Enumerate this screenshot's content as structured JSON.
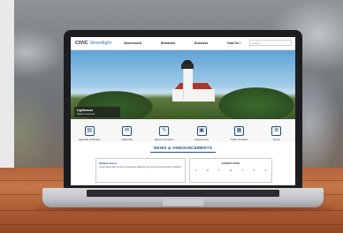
{
  "site": {
    "logo_main": "CIVIC",
    "logo_sub": "Streetlight",
    "nav": [
      "Government",
      "Residents",
      "Business",
      "How Do I"
    ],
    "search_placeholder": "Search",
    "topbar_button": "Sign In"
  },
  "hero": {
    "caption_title": "Lighthouse",
    "caption_sub": "Historic landmark"
  },
  "quick_links": [
    {
      "label": "Agendas & Minutes",
      "icon": "agenda-icon",
      "glyph": "▤"
    },
    {
      "label": "Notify Me",
      "icon": "mail-icon",
      "glyph": "✉"
    },
    {
      "label": "Report a Concern",
      "icon": "concern-icon",
      "glyph": "✎"
    },
    {
      "label": "Employment",
      "icon": "briefcase-icon",
      "glyph": "▣"
    },
    {
      "label": "Online Services",
      "icon": "services-icon",
      "glyph": "▦"
    },
    {
      "label": "Forms",
      "icon": "forms-icon",
      "glyph": "⚙"
    }
  ],
  "news": {
    "title": "NEWS & ANNOUNCEMENTS",
    "card_headline": "Sample Event",
    "card_text": "Lorem ipsum dolor sit amet consectetur adipiscing elit sed do eiusmod tempor incididunt"
  },
  "calendar": {
    "title": "EVENTS DATE",
    "days": [
      "S",
      "M",
      "T",
      "W",
      "T",
      "F",
      "S"
    ]
  }
}
